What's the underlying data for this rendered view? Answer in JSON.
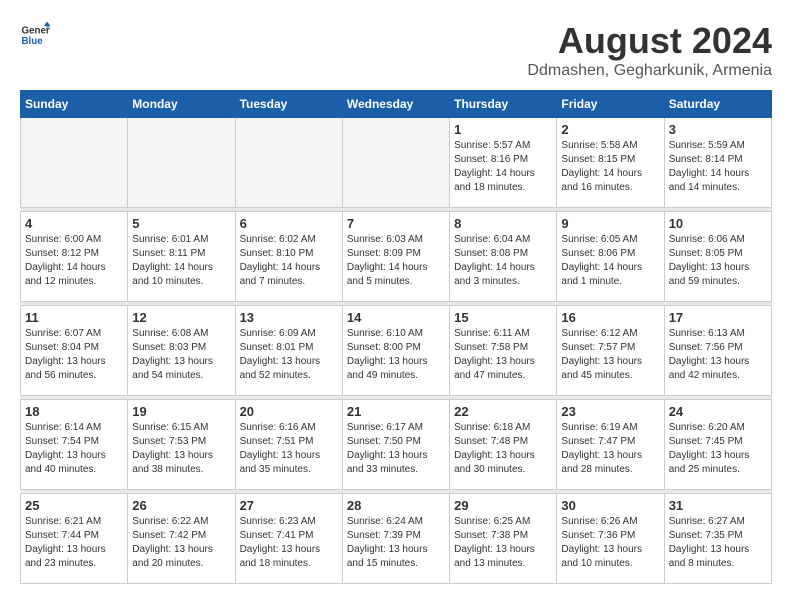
{
  "logo": {
    "text_general": "General",
    "text_blue": "Blue"
  },
  "header": {
    "title": "August 2024",
    "subtitle": "Ddmashen, Gegharkunik, Armenia"
  },
  "calendar": {
    "days_of_week": [
      "Sunday",
      "Monday",
      "Tuesday",
      "Wednesday",
      "Thursday",
      "Friday",
      "Saturday"
    ],
    "weeks": [
      {
        "days": [
          {
            "number": "",
            "info": "",
            "empty": true
          },
          {
            "number": "",
            "info": "",
            "empty": true
          },
          {
            "number": "",
            "info": "",
            "empty": true
          },
          {
            "number": "",
            "info": "",
            "empty": true
          },
          {
            "number": "1",
            "info": "Sunrise: 5:57 AM\nSunset: 8:16 PM\nDaylight: 14 hours\nand 18 minutes."
          },
          {
            "number": "2",
            "info": "Sunrise: 5:58 AM\nSunset: 8:15 PM\nDaylight: 14 hours\nand 16 minutes."
          },
          {
            "number": "3",
            "info": "Sunrise: 5:59 AM\nSunset: 8:14 PM\nDaylight: 14 hours\nand 14 minutes."
          }
        ]
      },
      {
        "days": [
          {
            "number": "4",
            "info": "Sunrise: 6:00 AM\nSunset: 8:12 PM\nDaylight: 14 hours\nand 12 minutes."
          },
          {
            "number": "5",
            "info": "Sunrise: 6:01 AM\nSunset: 8:11 PM\nDaylight: 14 hours\nand 10 minutes."
          },
          {
            "number": "6",
            "info": "Sunrise: 6:02 AM\nSunset: 8:10 PM\nDaylight: 14 hours\nand 7 minutes."
          },
          {
            "number": "7",
            "info": "Sunrise: 6:03 AM\nSunset: 8:09 PM\nDaylight: 14 hours\nand 5 minutes."
          },
          {
            "number": "8",
            "info": "Sunrise: 6:04 AM\nSunset: 8:08 PM\nDaylight: 14 hours\nand 3 minutes."
          },
          {
            "number": "9",
            "info": "Sunrise: 6:05 AM\nSunset: 8:06 PM\nDaylight: 14 hours\nand 1 minute."
          },
          {
            "number": "10",
            "info": "Sunrise: 6:06 AM\nSunset: 8:05 PM\nDaylight: 13 hours\nand 59 minutes."
          }
        ]
      },
      {
        "days": [
          {
            "number": "11",
            "info": "Sunrise: 6:07 AM\nSunset: 8:04 PM\nDaylight: 13 hours\nand 56 minutes."
          },
          {
            "number": "12",
            "info": "Sunrise: 6:08 AM\nSunset: 8:03 PM\nDaylight: 13 hours\nand 54 minutes."
          },
          {
            "number": "13",
            "info": "Sunrise: 6:09 AM\nSunset: 8:01 PM\nDaylight: 13 hours\nand 52 minutes."
          },
          {
            "number": "14",
            "info": "Sunrise: 6:10 AM\nSunset: 8:00 PM\nDaylight: 13 hours\nand 49 minutes."
          },
          {
            "number": "15",
            "info": "Sunrise: 6:11 AM\nSunset: 7:58 PM\nDaylight: 13 hours\nand 47 minutes."
          },
          {
            "number": "16",
            "info": "Sunrise: 6:12 AM\nSunset: 7:57 PM\nDaylight: 13 hours\nand 45 minutes."
          },
          {
            "number": "17",
            "info": "Sunrise: 6:13 AM\nSunset: 7:56 PM\nDaylight: 13 hours\nand 42 minutes."
          }
        ]
      },
      {
        "days": [
          {
            "number": "18",
            "info": "Sunrise: 6:14 AM\nSunset: 7:54 PM\nDaylight: 13 hours\nand 40 minutes."
          },
          {
            "number": "19",
            "info": "Sunrise: 6:15 AM\nSunset: 7:53 PM\nDaylight: 13 hours\nand 38 minutes."
          },
          {
            "number": "20",
            "info": "Sunrise: 6:16 AM\nSunset: 7:51 PM\nDaylight: 13 hours\nand 35 minutes."
          },
          {
            "number": "21",
            "info": "Sunrise: 6:17 AM\nSunset: 7:50 PM\nDaylight: 13 hours\nand 33 minutes."
          },
          {
            "number": "22",
            "info": "Sunrise: 6:18 AM\nSunset: 7:48 PM\nDaylight: 13 hours\nand 30 minutes."
          },
          {
            "number": "23",
            "info": "Sunrise: 6:19 AM\nSunset: 7:47 PM\nDaylight: 13 hours\nand 28 minutes."
          },
          {
            "number": "24",
            "info": "Sunrise: 6:20 AM\nSunset: 7:45 PM\nDaylight: 13 hours\nand 25 minutes."
          }
        ]
      },
      {
        "days": [
          {
            "number": "25",
            "info": "Sunrise: 6:21 AM\nSunset: 7:44 PM\nDaylight: 13 hours\nand 23 minutes."
          },
          {
            "number": "26",
            "info": "Sunrise: 6:22 AM\nSunset: 7:42 PM\nDaylight: 13 hours\nand 20 minutes."
          },
          {
            "number": "27",
            "info": "Sunrise: 6:23 AM\nSunset: 7:41 PM\nDaylight: 13 hours\nand 18 minutes."
          },
          {
            "number": "28",
            "info": "Sunrise: 6:24 AM\nSunset: 7:39 PM\nDaylight: 13 hours\nand 15 minutes."
          },
          {
            "number": "29",
            "info": "Sunrise: 6:25 AM\nSunset: 7:38 PM\nDaylight: 13 hours\nand 13 minutes."
          },
          {
            "number": "30",
            "info": "Sunrise: 6:26 AM\nSunset: 7:36 PM\nDaylight: 13 hours\nand 10 minutes."
          },
          {
            "number": "31",
            "info": "Sunrise: 6:27 AM\nSunset: 7:35 PM\nDaylight: 13 hours\nand 8 minutes."
          }
        ]
      }
    ]
  }
}
